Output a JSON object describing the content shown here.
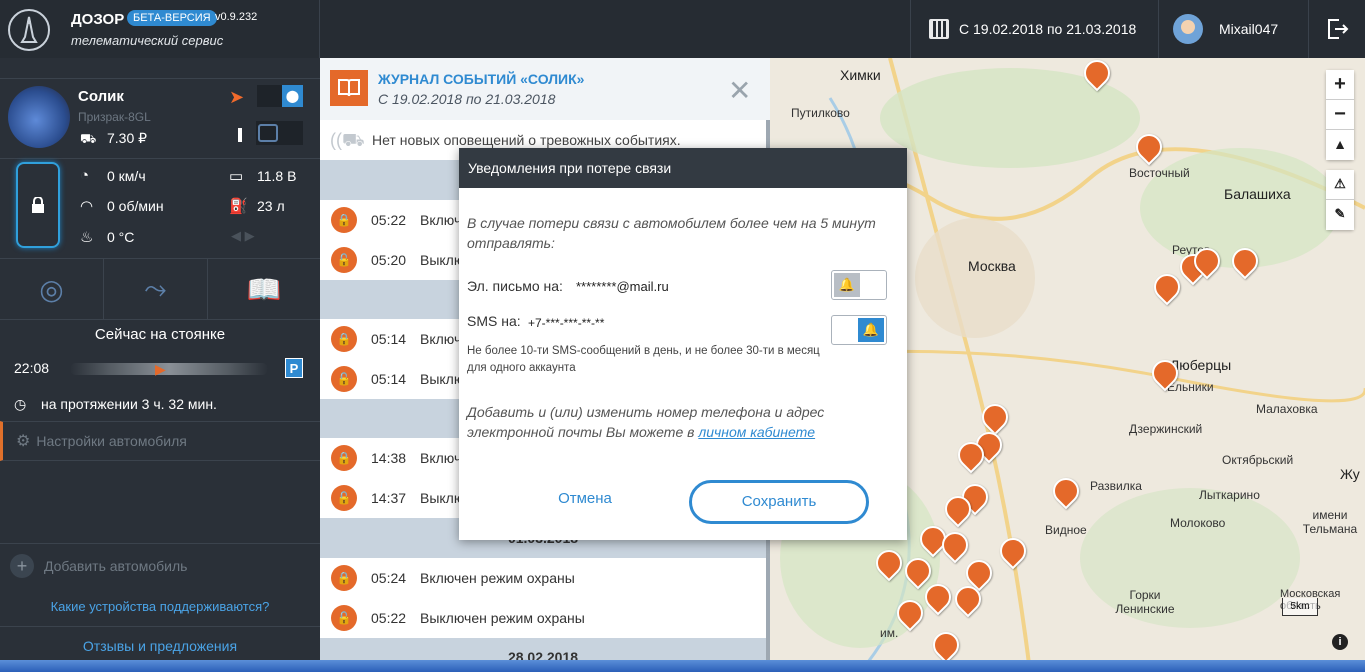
{
  "header": {
    "app_name": "ДОЗОР",
    "beta_badge": "БЕТА-ВЕРСИЯ",
    "version": "v0.9.232",
    "subtitle": "телематический сервис",
    "date_range": "С 19.02.2018 по 21.03.2018",
    "username": "Mixail047"
  },
  "sidebar": {
    "car_name": "Солик",
    "car_model": "Призрак-8GL",
    "balance": "7.30 ₽",
    "speed": "0 км/ч",
    "rpm": "0 об/мин",
    "temperature": "0 °C",
    "voltage": "11.8 В",
    "fuel": "23 л",
    "parking_status": "Сейчас на стоянке",
    "time": "22:08",
    "parking_letter": "P",
    "duration": "на протяжении 3 ч. 32 мин.",
    "settings_label": "Настройки автомобиля",
    "add_car_label": "Добавить автомобиль",
    "supported_devices_link": "Какие устройства поддерживаются?",
    "feedback_link": "Отзывы и предложения"
  },
  "journal": {
    "title": "ЖУРНАЛ СОБЫТИЙ «СОЛИК»",
    "subtitle": "С 19.02.2018 по 21.03.2018",
    "no_alerts": "Нет новых оповещений о тревожных событиях.",
    "events": [
      {
        "time": "05:22",
        "text": "Включ"
      },
      {
        "time": "05:20",
        "text": "Выклю"
      },
      {
        "time": "05:14",
        "text": "Включ"
      },
      {
        "time": "05:14",
        "text": "Выклю"
      },
      {
        "time": "14:38",
        "text": "Включ"
      },
      {
        "time": "14:37",
        "text": "Выклю"
      },
      {
        "time": "05:24",
        "text": "Включен режим охраны"
      },
      {
        "time": "05:22",
        "text": "Выключен режим охраны"
      }
    ],
    "dates": [
      "01.03.2018",
      "28.02.2018"
    ]
  },
  "map": {
    "labels": [
      "Химки",
      "Путилково",
      "Восточный",
      "Балашиха",
      "Москва",
      "Реутов",
      "Люберцы",
      "Ельники",
      "Малаховка",
      "Дзержинский",
      "Октябрьский",
      "Развилка",
      "Лыткарино",
      "Видное",
      "Молоково",
      "Горки Ленинские",
      "Московская область",
      "Жу",
      "имени Тельмана",
      "им."
    ],
    "scale": "5km",
    "zoom_in": "+",
    "zoom_out": "−"
  },
  "modal": {
    "title": "Уведомления при потере связи",
    "intro": "В случае потери связи с автомобилем более чем на 5 минут отправлять:",
    "email_label": "Эл. письмо на:",
    "email_value": "********@mail.ru",
    "sms_label": "SMS на:",
    "sms_value": "+7-***-***-**-**",
    "limit_note": "Не более 10-ти SMS-сообщений в день, и не более 30-ти в месяц для одного аккаунта",
    "info_text": "Добавить и (или) изменить номер телефона и адрес электронной почты Вы можете в",
    "info_link": "личном кабинете",
    "cancel_label": "Отмена",
    "save_label": "Сохранить",
    "email_enabled": false,
    "sms_enabled": true
  },
  "colors": {
    "accent": "#2f8ad1",
    "orange": "#e4692a",
    "dark": "#2a3038"
  }
}
